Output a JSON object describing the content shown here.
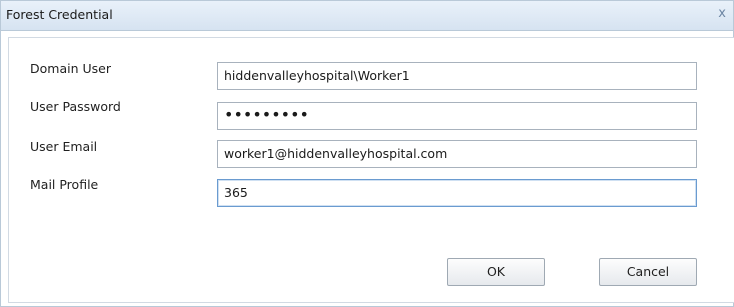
{
  "dialog": {
    "title": "Forest Credential",
    "close_label": "x"
  },
  "form": {
    "domain_user": {
      "label": "Domain User",
      "value": "hiddenvalleyhospital\\Worker1"
    },
    "user_password": {
      "label": "User Password",
      "value": "•••••••••"
    },
    "user_email": {
      "label": "User Email",
      "value": "worker1@hiddenvalleyhospital.com"
    },
    "mail_profile": {
      "label": "Mail Profile",
      "value": "365"
    }
  },
  "buttons": {
    "ok": "OK",
    "cancel": "Cancel"
  }
}
